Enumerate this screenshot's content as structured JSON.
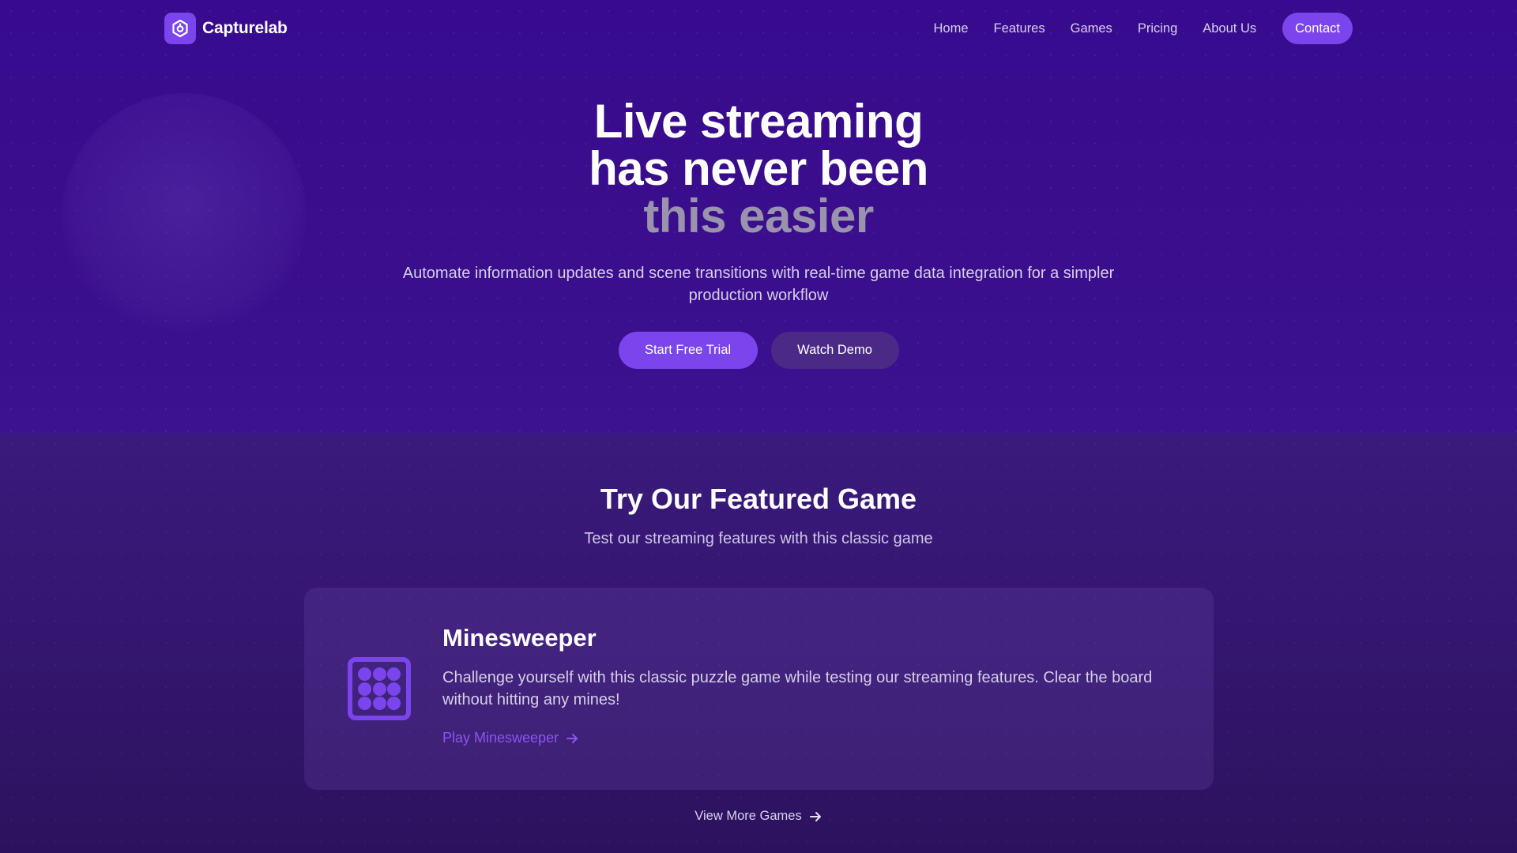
{
  "brand": {
    "name": "Capturelab"
  },
  "nav": {
    "links": [
      "Home",
      "Features",
      "Games",
      "Pricing",
      "About Us"
    ],
    "contact": "Contact"
  },
  "hero": {
    "title_line1": "Live streaming",
    "title_line2": "has never been",
    "title_line3": "this easier",
    "subtitle": "Automate information updates and scene transitions with real-time game data integration for a simpler production workflow",
    "primary_cta": "Start Free Trial",
    "secondary_cta": "Watch Demo"
  },
  "featured": {
    "title": "Try Our Featured Game",
    "subtitle": "Test our streaming features with this classic game",
    "game": {
      "name": "Minesweeper",
      "description": "Challenge yourself with this classic puzzle game while testing our streaming features. Clear the board without hitting any mines!",
      "link": "Play Minesweeper"
    },
    "more": "View More Games"
  },
  "colors": {
    "accent": "#7b45ee",
    "hero_bg": "#380b8e",
    "section_bg": "#34166f"
  }
}
